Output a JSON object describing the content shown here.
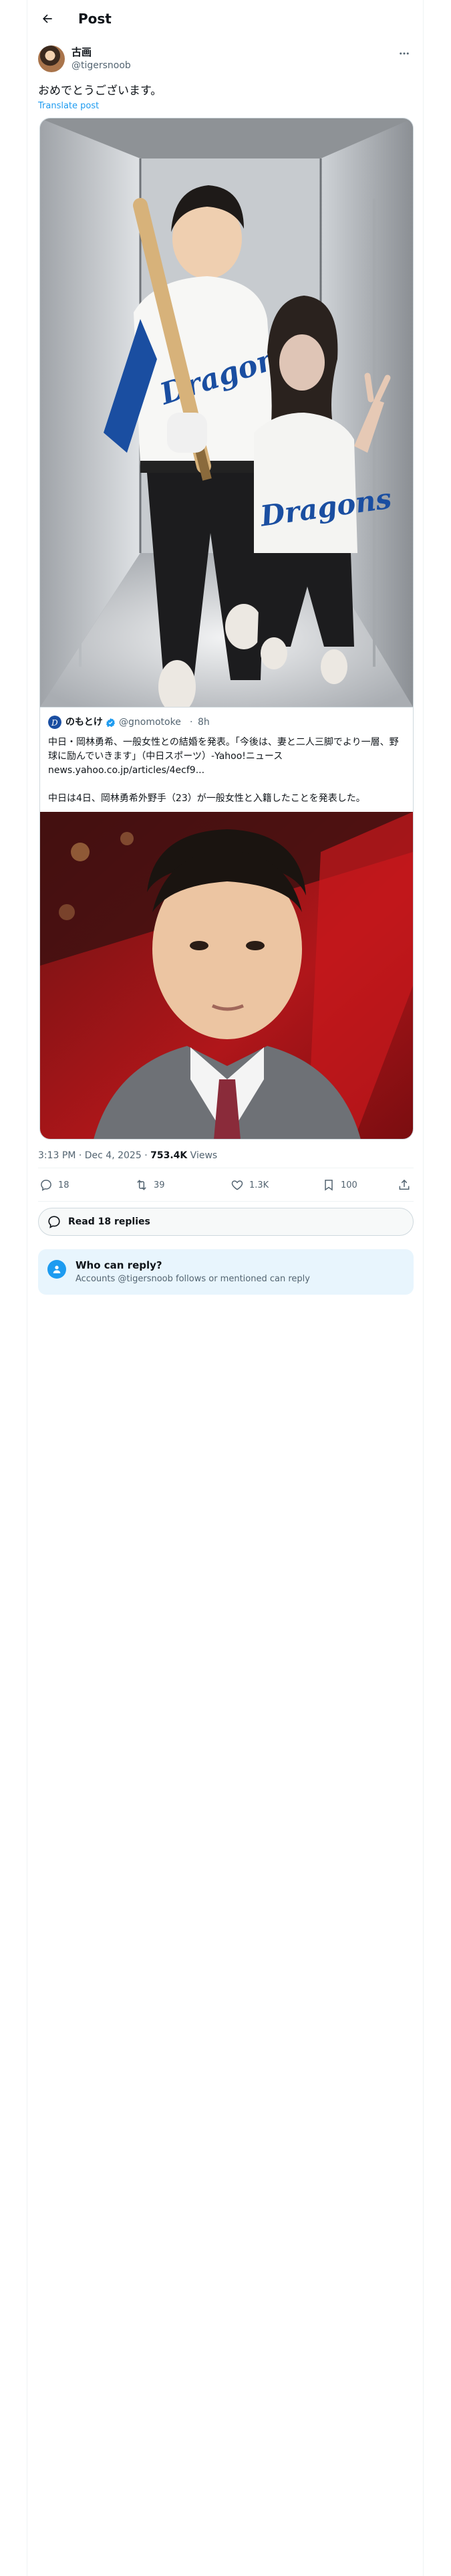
{
  "header": {
    "title": "Post"
  },
  "author": {
    "name": "古画",
    "handle": "@tigersnoob"
  },
  "post": {
    "text": "おめでとうございます。",
    "translate_label": "Translate post"
  },
  "quote": {
    "name": "のもとけ",
    "handle": "@gnomotoke",
    "separator": "·",
    "time": "8h",
    "text": "中日・岡林勇希、一般女性との結婚を発表。「今後は、妻と二人三脚でより一層、野球に励んでいきます」（中日スポーツ）-Yahoo!ニュース\nnews.yahoo.co.jp/articles/4ecf9...\n\n中日は4日、岡林勇希外野手（23）が一般女性と入籍したことを発表した。"
  },
  "meta": {
    "timestamp": "3:13 PM · Dec 4, 2025 · ",
    "views_count": "753.4K",
    "views_label": " Views"
  },
  "actions": {
    "replies": "18",
    "reposts": "39",
    "likes": "1.3K",
    "bookmarks": "100"
  },
  "read_replies": {
    "label": "Read 18 replies"
  },
  "who_can_reply": {
    "title": "Who can reply?",
    "subtitle": "Accounts @tigersnoob follows or mentioned can reply"
  },
  "jersey_text": "Dragons",
  "colors": {
    "accent": "#1d9bf0",
    "text_secondary": "#536471",
    "border": "#cfd9de",
    "info_bg": "#e8f5fd",
    "dragons_blue": "#1a4ea1"
  },
  "icons": [
    "back-arrow-icon",
    "more-icon",
    "verified-badge-icon",
    "reply-icon",
    "repost-icon",
    "like-icon",
    "bookmark-icon",
    "share-icon",
    "speech-bubble-icon",
    "user-icon"
  ]
}
